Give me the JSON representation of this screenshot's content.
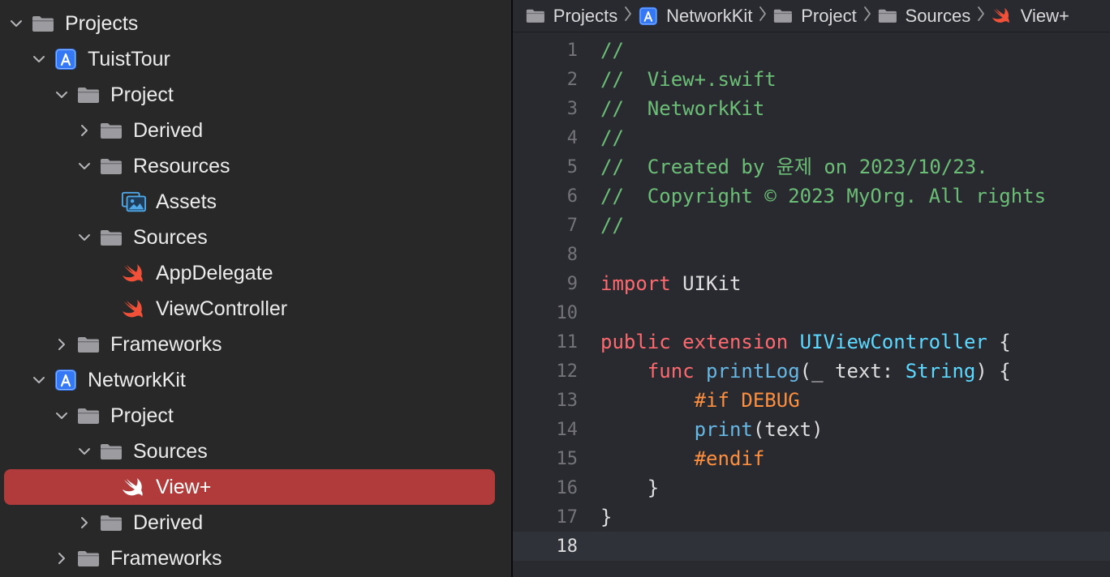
{
  "colors": {
    "sidebar_bg": "#282828",
    "editor_bg": "#292a30",
    "selection": "#b13b3a",
    "folder_icon": "#9b9ba0",
    "project_icon": "#3478f6",
    "swift_orange": "#f05138",
    "assets_icon": "#4fa7e8",
    "comment": "#6cbe77",
    "keyword": "#fc6a6f",
    "type": "#5dd8ff",
    "function": "#67b7e4",
    "preprocessor": "#fd8f3f",
    "plain": "#dfdfe0"
  },
  "sidebar": {
    "items": [
      {
        "label": "Projects",
        "icon": "folder-icon",
        "level": 0,
        "chevron": "down"
      },
      {
        "label": "TuistTour",
        "icon": "app-project-icon",
        "level": 1,
        "chevron": "down"
      },
      {
        "label": "Project",
        "icon": "folder-icon",
        "level": 2,
        "chevron": "down"
      },
      {
        "label": "Derived",
        "icon": "folder-icon",
        "level": 3,
        "chevron": "right"
      },
      {
        "label": "Resources",
        "icon": "folder-icon",
        "level": 3,
        "chevron": "down"
      },
      {
        "label": "Assets",
        "icon": "assets-icon",
        "level": 4,
        "chevron": "none"
      },
      {
        "label": "Sources",
        "icon": "folder-icon",
        "level": 3,
        "chevron": "down"
      },
      {
        "label": "AppDelegate",
        "icon": "swift-icon",
        "level": 4,
        "chevron": "none"
      },
      {
        "label": "ViewController",
        "icon": "swift-icon",
        "level": 4,
        "chevron": "none"
      },
      {
        "label": "Frameworks",
        "icon": "folder-icon",
        "level": 2,
        "chevron": "right"
      },
      {
        "label": "NetworkKit",
        "icon": "app-project-icon",
        "level": 1,
        "chevron": "down"
      },
      {
        "label": "Project",
        "icon": "folder-icon",
        "level": 2,
        "chevron": "down"
      },
      {
        "label": "Sources",
        "icon": "folder-icon",
        "level": 3,
        "chevron": "down"
      },
      {
        "label": "View+",
        "icon": "swift-icon",
        "level": 4,
        "chevron": "none",
        "selected": true
      },
      {
        "label": "Derived",
        "icon": "folder-icon",
        "level": 3,
        "chevron": "right"
      },
      {
        "label": "Frameworks",
        "icon": "folder-icon",
        "level": 2,
        "chevron": "right"
      }
    ]
  },
  "jumpbar": {
    "crumbs": [
      {
        "label": "Projects",
        "icon": "folder-icon"
      },
      {
        "label": "NetworkKit",
        "icon": "app-project-icon"
      },
      {
        "label": "Project",
        "icon": "folder-icon"
      },
      {
        "label": "Sources",
        "icon": "folder-icon"
      },
      {
        "label": "View+",
        "icon": "swift-icon"
      }
    ]
  },
  "editor": {
    "current_line": 18,
    "lines": [
      [
        {
          "t": "//",
          "c": "comment"
        }
      ],
      [
        {
          "t": "//  View+.swift",
          "c": "comment"
        }
      ],
      [
        {
          "t": "//  NetworkKit",
          "c": "comment"
        }
      ],
      [
        {
          "t": "//",
          "c": "comment"
        }
      ],
      [
        {
          "t": "//  Created by 윤제 on 2023/10/23.",
          "c": "comment"
        }
      ],
      [
        {
          "t": "//  Copyright © 2023 MyOrg. All rights",
          "c": "comment"
        }
      ],
      [
        {
          "t": "//",
          "c": "comment"
        }
      ],
      [],
      [
        {
          "t": "import",
          "c": "keyword"
        },
        {
          "t": " UIKit",
          "c": "plain"
        }
      ],
      [],
      [
        {
          "t": "public",
          "c": "keyword"
        },
        {
          "t": " ",
          "c": "plain"
        },
        {
          "t": "extension",
          "c": "keyword"
        },
        {
          "t": " ",
          "c": "plain"
        },
        {
          "t": "UIViewController",
          "c": "type"
        },
        {
          "t": " {",
          "c": "plain"
        }
      ],
      [
        {
          "t": "    ",
          "c": "plain"
        },
        {
          "t": "func",
          "c": "keyword"
        },
        {
          "t": " ",
          "c": "plain"
        },
        {
          "t": "printLog",
          "c": "function"
        },
        {
          "t": "(_ text: ",
          "c": "plain"
        },
        {
          "t": "String",
          "c": "type"
        },
        {
          "t": ") {",
          "c": "plain"
        }
      ],
      [
        {
          "t": "        ",
          "c": "plain"
        },
        {
          "t": "#if DEBUG",
          "c": "pre"
        }
      ],
      [
        {
          "t": "        ",
          "c": "plain"
        },
        {
          "t": "print",
          "c": "function"
        },
        {
          "t": "(text)",
          "c": "plain"
        }
      ],
      [
        {
          "t": "        ",
          "c": "plain"
        },
        {
          "t": "#endif",
          "c": "pre"
        }
      ],
      [
        {
          "t": "    }",
          "c": "plain"
        }
      ],
      [
        {
          "t": "}",
          "c": "plain"
        }
      ],
      []
    ]
  }
}
